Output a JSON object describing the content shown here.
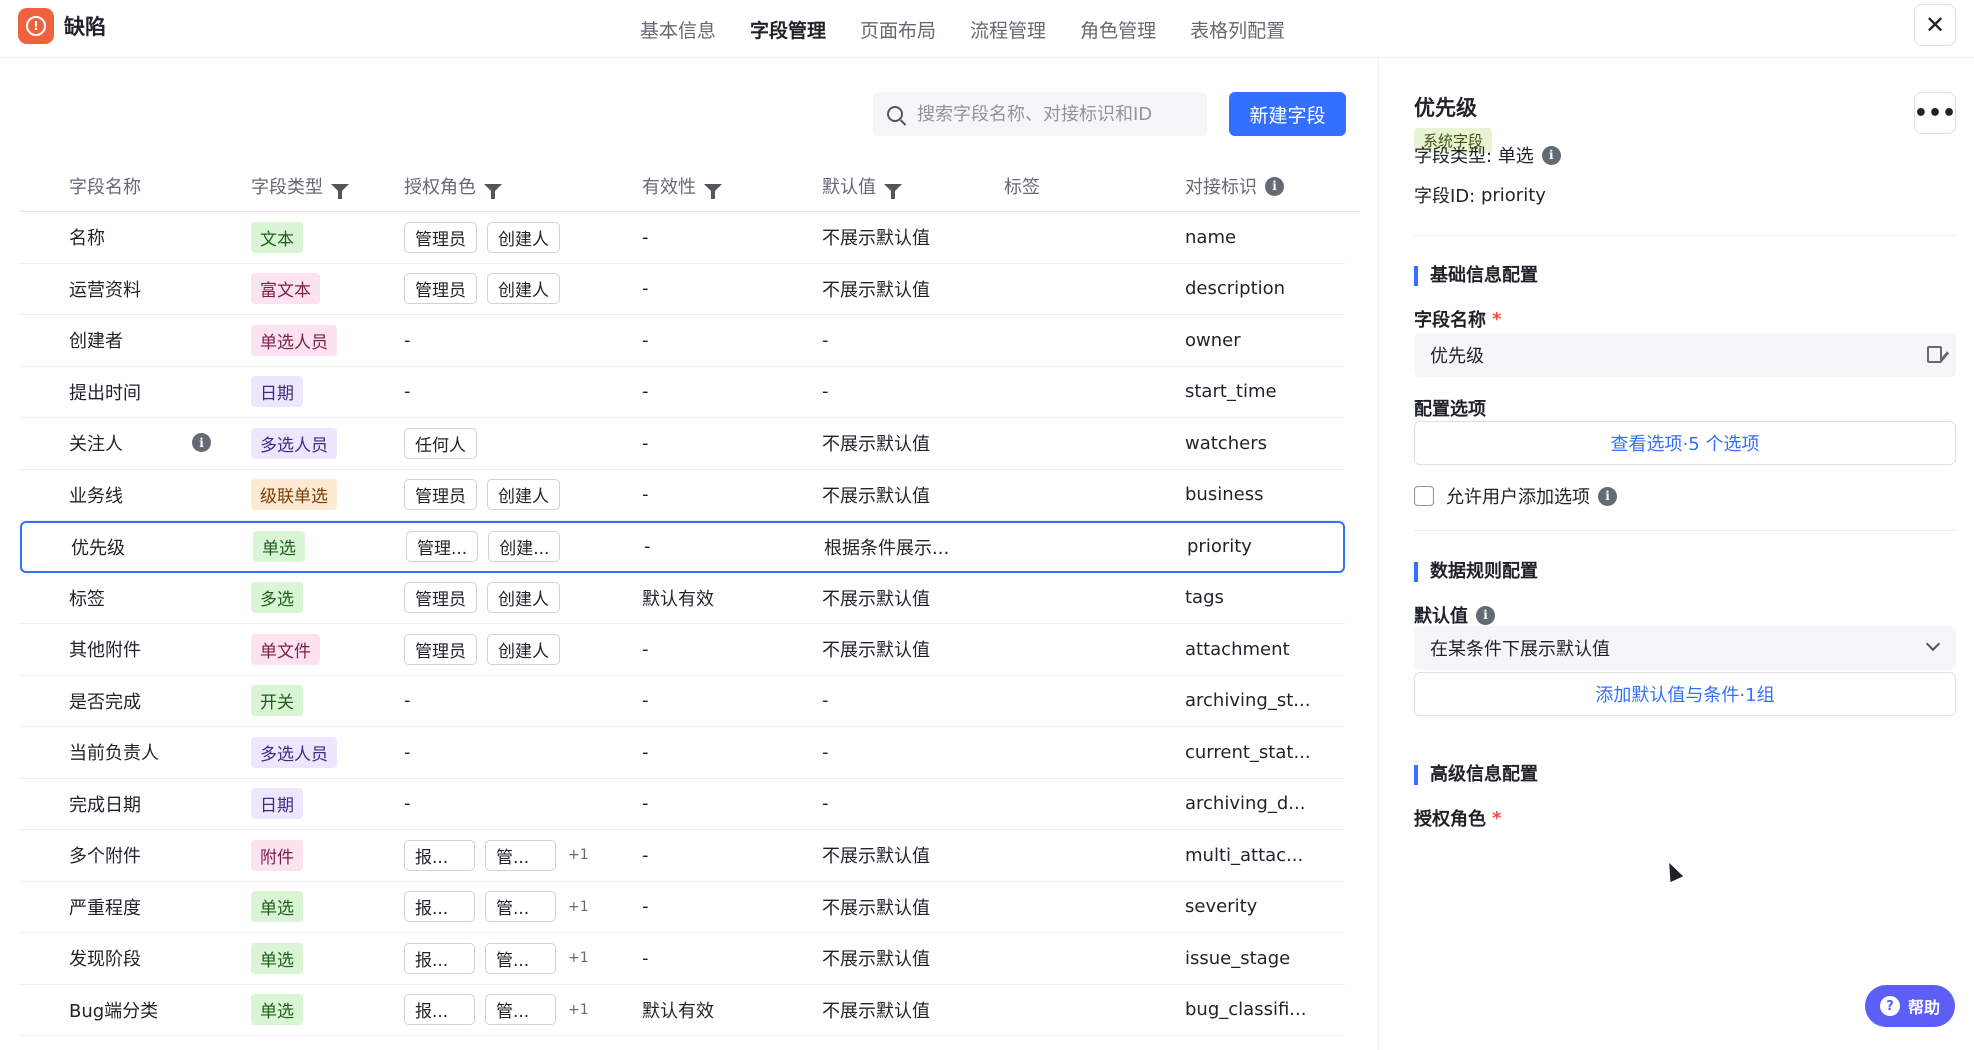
{
  "app": {
    "title": "缺陷",
    "logo_icon": "alert-circle-icon",
    "accent": "#3370ff",
    "logo_color": "#f0623d"
  },
  "nav": {
    "tabs": [
      "基本信息",
      "字段管理",
      "页面布局",
      "流程管理",
      "角色管理",
      "表格列配置"
    ],
    "active_tab": "字段管理"
  },
  "close_label": "✕",
  "toolbar": {
    "search_placeholder": "搜索字段名称、对接标识和ID",
    "new_field_label": "新建字段"
  },
  "table": {
    "columns": {
      "name": "字段名称",
      "type": "字段类型",
      "roles": "授权角色",
      "validity": "有效性",
      "default": "默认值",
      "tag": "标签",
      "key": "对接标识"
    },
    "rows": [
      {
        "name": "名称",
        "type": "文本",
        "type_color": "green",
        "roles": [
          "管理员",
          "创建人"
        ],
        "more": "",
        "validity": "-",
        "default": "不展示默认值",
        "key": "name"
      },
      {
        "name": "运营资料",
        "type": "富文本",
        "type_color": "pink",
        "roles": [
          "管理员",
          "创建人"
        ],
        "more": "",
        "validity": "-",
        "default": "不展示默认值",
        "key": "description"
      },
      {
        "name": "创建者",
        "type": "单选人员",
        "type_color": "pink",
        "roles": [],
        "roles_empty": "-",
        "more": "",
        "validity": "-",
        "default": "-",
        "key": "owner"
      },
      {
        "name": "提出时间",
        "type": "日期",
        "type_color": "purple",
        "roles": [],
        "roles_empty": "-",
        "more": "",
        "validity": "-",
        "default": "-",
        "key": "start_time"
      },
      {
        "name": "关注人",
        "type": "多选人员",
        "type_color": "purple",
        "roles": [
          "任何人"
        ],
        "more": "",
        "validity": "-",
        "default": "不展示默认值",
        "key": "watchers",
        "has_info": true
      },
      {
        "name": "业务线",
        "type": "级联单选",
        "type_color": "orange",
        "roles": [
          "管理员",
          "创建人"
        ],
        "more": "",
        "validity": "-",
        "default": "不展示默认值",
        "key": "business"
      },
      {
        "name": "优先级",
        "type": "单选",
        "type_color": "green",
        "roles": [
          "管理...",
          "创建..."
        ],
        "more": "",
        "validity": "-",
        "default": "根据条件展示...",
        "key": "priority",
        "selected": true
      },
      {
        "name": "标签",
        "type": "多选",
        "type_color": "green",
        "roles": [
          "管理员",
          "创建人"
        ],
        "more": "",
        "validity": "默认有效",
        "default": "不展示默认值",
        "key": "tags"
      },
      {
        "name": "其他附件",
        "type": "单文件",
        "type_color": "pink",
        "roles": [
          "管理员",
          "创建人"
        ],
        "more": "",
        "validity": "-",
        "default": "不展示默认值",
        "key": "attachment"
      },
      {
        "name": "是否完成",
        "type": "开关",
        "type_color": "green",
        "roles": [],
        "roles_empty": "-",
        "more": "",
        "validity": "-",
        "default": "-",
        "key": "archiving_st..."
      },
      {
        "name": "当前负责人",
        "type": "多选人员",
        "type_color": "purple",
        "roles": [],
        "roles_empty": "-",
        "more": "",
        "validity": "-",
        "default": "-",
        "key": "current_stat..."
      },
      {
        "name": "完成日期",
        "type": "日期",
        "type_color": "purple",
        "roles": [],
        "roles_empty": "-",
        "more": "",
        "validity": "-",
        "default": "-",
        "key": "archiving_d..."
      },
      {
        "name": "多个附件",
        "type": "附件",
        "type_color": "pink",
        "roles": [
          "报...",
          "管..."
        ],
        "more": "+1",
        "validity": "-",
        "default": "不展示默认值",
        "key": "multi_attac..."
      },
      {
        "name": "严重程度",
        "type": "单选",
        "type_color": "green",
        "roles": [
          "报...",
          "管..."
        ],
        "more": "+1",
        "validity": "-",
        "default": "不展示默认值",
        "key": "severity"
      },
      {
        "name": "发现阶段",
        "type": "单选",
        "type_color": "green",
        "roles": [
          "报...",
          "管..."
        ],
        "more": "+1",
        "validity": "-",
        "default": "不展示默认值",
        "key": "issue_stage"
      },
      {
        "name": "Bug端分类",
        "type": "单选",
        "type_color": "green",
        "roles": [
          "报...",
          "管..."
        ],
        "more": "+1",
        "validity": "默认有效",
        "default": "不展示默认值",
        "key": "bug_classifi..."
      }
    ]
  },
  "tag_colors": {
    "green": {
      "bg": "#d9f5d6",
      "fg": "#1f5e1a"
    },
    "pink": {
      "bg": "#fde2ef",
      "fg": "#7a1f4a"
    },
    "purple": {
      "bg": "#ece7fd",
      "fg": "#3f2a8a"
    },
    "orange": {
      "bg": "#feead2",
      "fg": "#7a3d08"
    }
  },
  "panel": {
    "title": "优先级",
    "system_badge": "系统字段",
    "more_label": "•••",
    "field_type_label": "字段类型:",
    "field_type_value": "单选",
    "field_id_label": "字段ID:",
    "field_id_value": "priority",
    "section_basic": "基础信息配置",
    "name_label": "字段名称",
    "required_mark": "*",
    "name_value": "优先级",
    "options_label": "配置选项",
    "options_button": "查看选项·5 个选项",
    "allow_add_label": "允许用户添加选项",
    "section_rules": "数据规则配置",
    "default_label": "默认值",
    "default_select": "在某条件下展示默认值",
    "add_default_button": "添加默认值与条件·1组",
    "section_advanced": "高级信息配置",
    "roles_label": "授权角色"
  },
  "help_label": "帮助"
}
